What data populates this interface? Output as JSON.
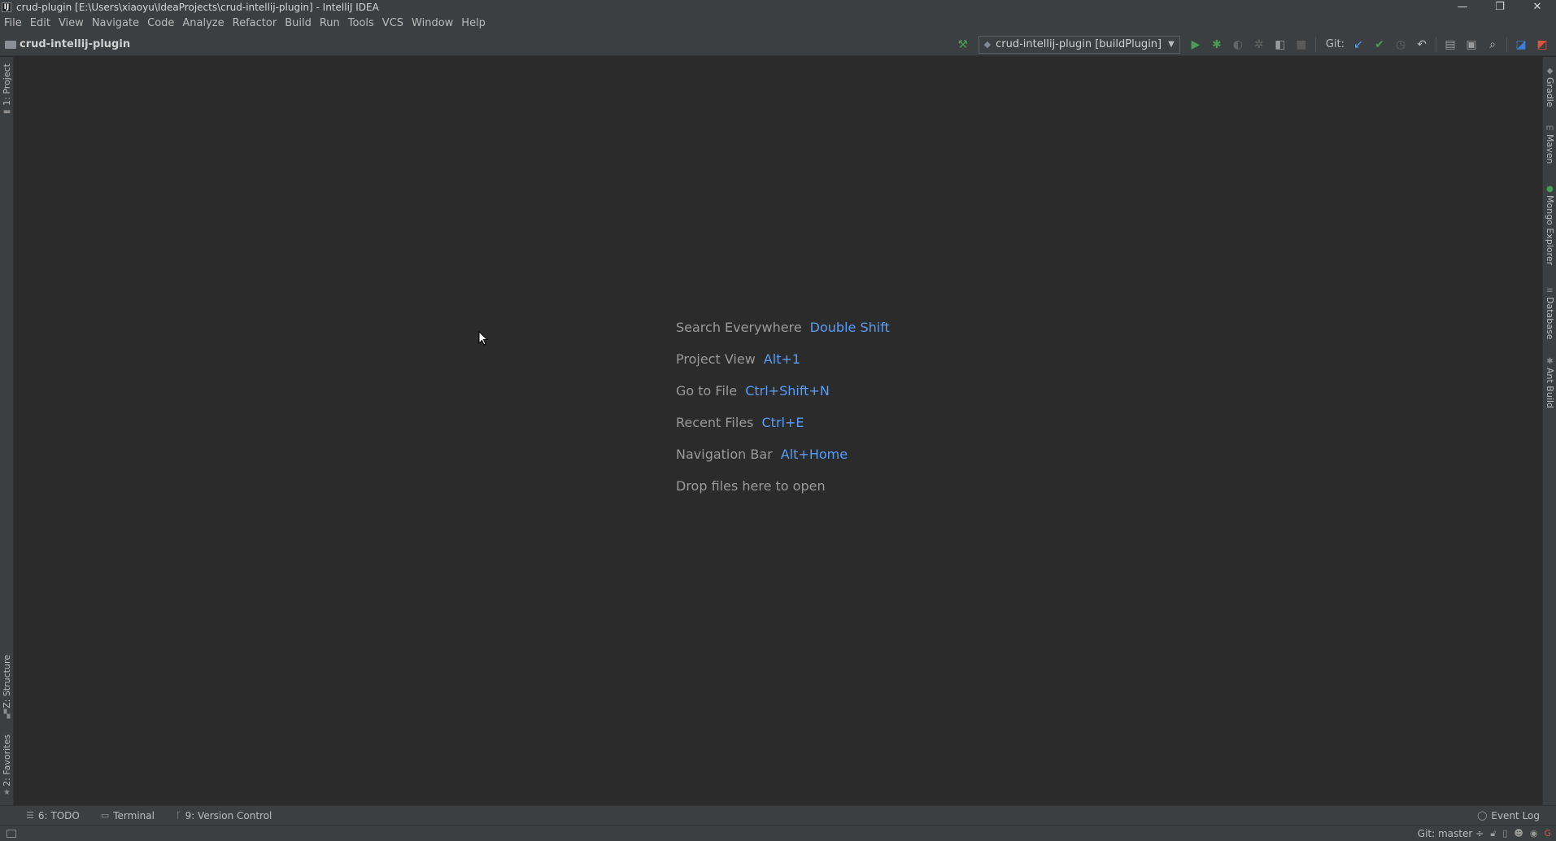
{
  "window": {
    "app_icon": "IJ",
    "title": "crud-plugin [E:\\Users\\xiaoyu\\IdeaProjects\\crud-intellij-plugin] - IntelliJ IDEA",
    "minimize": "—",
    "maximize": "❐",
    "close": "✕"
  },
  "menu": [
    "File",
    "Edit",
    "View",
    "Navigate",
    "Code",
    "Analyze",
    "Refactor",
    "Build",
    "Run",
    "Tools",
    "VCS",
    "Window",
    "Help"
  ],
  "navbar": {
    "project": "crud-intellij-plugin",
    "run_config": "crud-intellij-plugin [buildPlugin]",
    "git_label": "Git:"
  },
  "left_tabs": {
    "project": "1: Project",
    "structure": "Z: Structure",
    "favorites": "2: Favorites"
  },
  "right_tabs": {
    "gradle": "Gradle",
    "maven": "Maven",
    "mongo": "Mongo Explorer",
    "database": "Database",
    "ant": "Ant Build"
  },
  "hints": [
    {
      "label": "Search Everywhere",
      "shortcut": "Double Shift"
    },
    {
      "label": "Project View",
      "shortcut": "Alt+1"
    },
    {
      "label": "Go to File",
      "shortcut": "Ctrl+Shift+N"
    },
    {
      "label": "Recent Files",
      "shortcut": "Ctrl+E"
    },
    {
      "label": "Navigation Bar",
      "shortcut": "Alt+Home"
    },
    {
      "label": "Drop files here to open",
      "shortcut": ""
    }
  ],
  "bottom_tabs": {
    "todo": "6: TODO",
    "terminal": "Terminal",
    "vcs": "9: Version Control",
    "event_log": "Event Log"
  },
  "status": {
    "git_branch": "Git: master ÷"
  },
  "colors": {
    "background": "#2b2b2b",
    "chrome": "#3c3f41",
    "shortcut": "#589df6",
    "run_green": "#499c54"
  }
}
